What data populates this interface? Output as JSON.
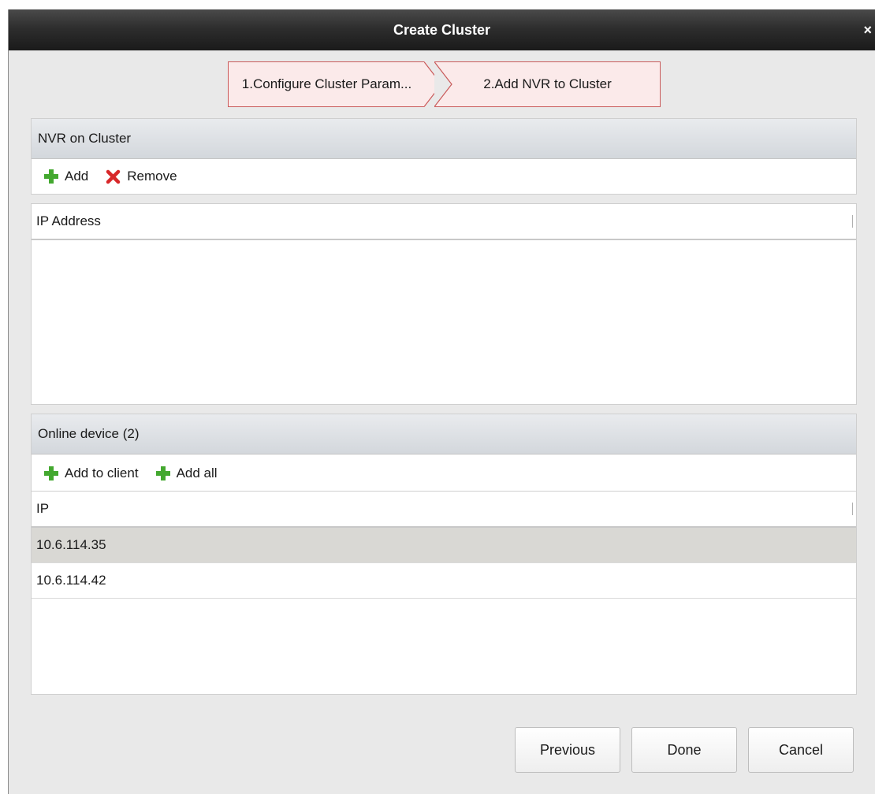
{
  "dialog": {
    "title": "Create Cluster",
    "close_glyph": "×"
  },
  "steps": [
    {
      "label": "1.Configure Cluster Param..."
    },
    {
      "label": "2.Add NVR to Cluster"
    }
  ],
  "nvr_panel": {
    "title": "NVR on Cluster",
    "add_label": "Add",
    "remove_label": "Remove",
    "column_header": "IP Address",
    "rows": []
  },
  "online_panel": {
    "title": "Online device (2)",
    "add_to_client_label": "Add to client",
    "add_all_label": "Add all",
    "column_header": "IP",
    "rows": [
      {
        "ip": "10.6.114.35"
      },
      {
        "ip": "10.6.114.42"
      }
    ]
  },
  "buttons": {
    "previous": "Previous",
    "done": "Done",
    "cancel": "Cancel"
  },
  "colors": {
    "plus_icon": "#43a82f",
    "remove_icon": "#d8282a",
    "step_border": "#c95a5a",
    "step_fill": "#fbeaea",
    "selected_row": "#d9d8d4"
  },
  "icons": {
    "add": "plus-icon",
    "remove": "x-icon",
    "close": "close-icon"
  }
}
